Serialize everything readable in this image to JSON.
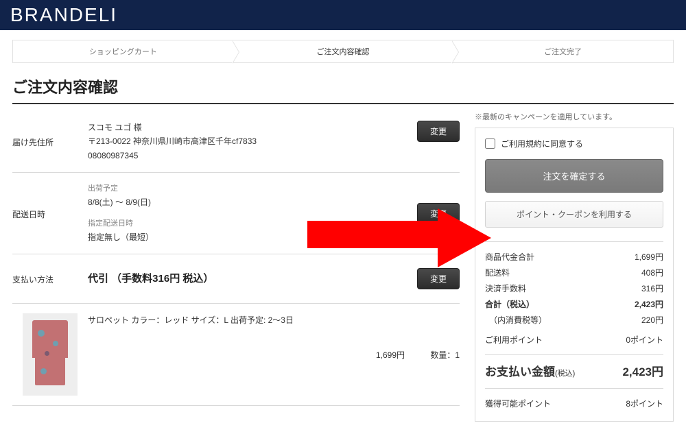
{
  "brand": "BRANDELI",
  "progress": {
    "step1": "ショッピングカート",
    "step2": "ご注文内容確認",
    "step3": "ご注文完了"
  },
  "page_title": "ご注文内容確認",
  "sections": {
    "shipping": {
      "label": "届け先住所",
      "name": "スコモ ユゴ 様",
      "address": "〒213-0022 神奈川県川崎市高津区千年cf7833",
      "phone": "08080987345",
      "change": "変更"
    },
    "delivery": {
      "label": "配送日時",
      "ship_label": "出荷予定",
      "ship_value": "8/8(土) ～ 8/9(日)",
      "spec_label": "指定配送日時",
      "spec_value": "指定無し（最短）",
      "change": "変更"
    },
    "payment": {
      "label": "支払い方法",
      "method": "代引 （手数料316円 税込）",
      "change": "変更"
    }
  },
  "item": {
    "name": "サロペット",
    "color": "カラー：レッド",
    "size": "サイズ：L",
    "ship": "出荷予定: 2〜3日",
    "price": "1,699円",
    "qty": "数量：1"
  },
  "side": {
    "note": "※最新のキャンペーンを適用しています。",
    "agree": "ご利用規約に同意する",
    "confirm": "注文を確定する",
    "coupon": "ポイント・クーポンを利用する"
  },
  "summary": {
    "subtotal_k": "商品代金合計",
    "subtotal_v": "1,699円",
    "ship_k": "配送料",
    "ship_v": "408円",
    "fee_k": "決済手数料",
    "fee_v": "316円",
    "total_k": "合計（税込）",
    "total_v": "2,423円",
    "inner_k": "（内消費税等）",
    "inner_v": "220円",
    "point_k": "ご利用ポイント",
    "point_v": "0ポイント",
    "pay_k": "お支払い金額",
    "pay_tax": "(税込)",
    "pay_v": "2,423円",
    "earn_k": "獲得可能ポイント",
    "earn_v": "8ポイント"
  }
}
